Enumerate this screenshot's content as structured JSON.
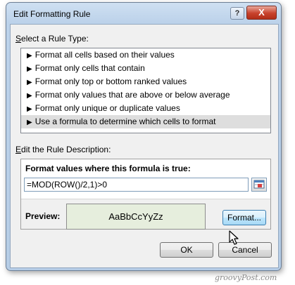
{
  "window": {
    "title": "Edit Formatting Rule",
    "help_label": "?",
    "close_label": "X"
  },
  "rule_type": {
    "label_prefix": "",
    "label_accel": "S",
    "label_rest": "elect a Rule Type:",
    "items": [
      {
        "label": "Format all cells based on their values",
        "selected": false
      },
      {
        "label": "Format only cells that contain",
        "selected": false
      },
      {
        "label": "Format only top or bottom ranked values",
        "selected": false
      },
      {
        "label": "Format only values that are above or below average",
        "selected": false
      },
      {
        "label": "Format only unique or duplicate values",
        "selected": false
      },
      {
        "label": "Use a formula to determine which cells to format",
        "selected": true
      }
    ]
  },
  "description": {
    "label_prefix": "",
    "label_accel": "E",
    "label_rest": "dit the Rule Description:",
    "formula_heading": "Format values where this formula is true:",
    "formula_value": "=MOD(ROW()/2,1)>0"
  },
  "preview": {
    "label": "Preview:",
    "sample_text": "AaBbCcYyZz",
    "format_button": "Format..."
  },
  "buttons": {
    "ok": "OK",
    "cancel": "Cancel"
  },
  "watermark": "groovyPost.com",
  "colors": {
    "selected_row": "#dedede",
    "preview_fill": "#e6eedd",
    "close_button": "#c8422c"
  }
}
